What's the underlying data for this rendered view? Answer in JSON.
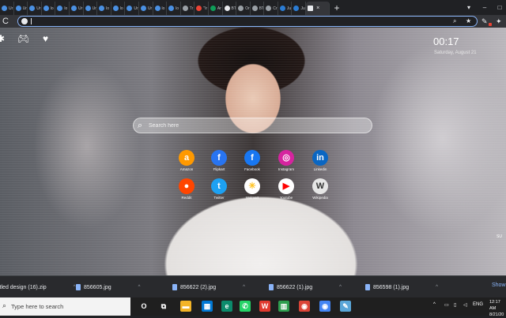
{
  "tabs": [
    {
      "label": "Ur",
      "icon": "chrome-extension-icon",
      "color": "#4a90e2"
    },
    {
      "label": "Ur",
      "icon": "chrome-extension-icon",
      "color": "#4a90e2"
    },
    {
      "label": "Ur",
      "icon": "chrome-extension-icon",
      "color": "#4a90e2"
    },
    {
      "label": "lo",
      "icon": "chrome-extension-icon",
      "color": "#4a90e2"
    },
    {
      "label": "lo",
      "icon": "chrome-extension-icon",
      "color": "#4a90e2"
    },
    {
      "label": "Ur",
      "icon": "chrome-extension-icon",
      "color": "#4a90e2"
    },
    {
      "label": "Ur",
      "icon": "chrome-extension-icon",
      "color": "#4a90e2"
    },
    {
      "label": "lo",
      "icon": "chrome-extension-icon",
      "color": "#4a90e2"
    },
    {
      "label": "lo",
      "icon": "chrome-extension-icon",
      "color": "#4a90e2"
    },
    {
      "label": "Ur",
      "icon": "chrome-extension-icon",
      "color": "#4a90e2"
    },
    {
      "label": "Ur",
      "icon": "chrome-extension-icon",
      "color": "#4a90e2"
    },
    {
      "label": "lo",
      "icon": "chrome-extension-icon",
      "color": "#4a90e2"
    },
    {
      "label": "lo",
      "icon": "chrome-extension-icon",
      "color": "#4a90e2"
    },
    {
      "label": "Tr",
      "icon": "globe-icon",
      "color": "#9aa0a6"
    },
    {
      "label": "\"Ir",
      "icon": "gmail-icon",
      "color": "#ea4335"
    },
    {
      "label": "Ar",
      "icon": "sheets-icon",
      "color": "#0f9d58"
    },
    {
      "label": "BT",
      "icon": "chrome-icon",
      "color": "#e8eaed"
    },
    {
      "label": "Or",
      "icon": "globe-icon",
      "color": "#9aa0a6"
    },
    {
      "label": "BT",
      "icon": "globe-icon",
      "color": "#9aa0a6"
    },
    {
      "label": "Cr",
      "icon": "globe-icon",
      "color": "#9aa0a6"
    },
    {
      "label": "Ju",
      "icon": "word-icon",
      "color": "#2b7cd3"
    },
    {
      "label": "Ju",
      "icon": "word-icon",
      "color": "#2b7cd3"
    }
  ],
  "active_tab": {
    "icon": "photo-icon",
    "close": "×"
  },
  "new_tab": "+",
  "window_controls": {
    "minimize": "–",
    "menu": "▾"
  },
  "toolbar": {
    "reload": "C",
    "omnibox_value": "",
    "colors": {
      "focus": "#8ab4f8",
      "ext_badge": "#ea4335"
    }
  },
  "page": {
    "clock": "00:17",
    "date": "Saturday, August 21",
    "search_placeholder": "Search here",
    "corner_text": "SU"
  },
  "apps": [
    {
      "label": "Amazon",
      "icon": "amazon-icon",
      "color": "#ff9900",
      "glyph": "a"
    },
    {
      "label": "Flipkart",
      "icon": "flipkart-icon",
      "color": "#2874f0",
      "glyph": "f"
    },
    {
      "label": "Facebook",
      "icon": "facebook-icon",
      "color": "#1877f2",
      "glyph": "f"
    },
    {
      "label": "Instagram",
      "icon": "instagram-icon",
      "color": "#d6249f",
      "glyph": "◎"
    },
    {
      "label": "Linkedin",
      "icon": "linkedin-icon",
      "color": "#0a66c2",
      "glyph": "in"
    },
    {
      "label": "Reddit",
      "icon": "reddit-icon",
      "color": "#ff4500",
      "glyph": "●"
    },
    {
      "label": "Twitter",
      "icon": "twitter-icon",
      "color": "#1da1f2",
      "glyph": "t"
    },
    {
      "label": "Walmart",
      "icon": "walmart-icon",
      "color": "#ffffff",
      "glyph": "✳"
    },
    {
      "label": "Youtube",
      "icon": "youtube-icon",
      "color": "#ffffff",
      "glyph": "▶"
    },
    {
      "label": "Wikipedia",
      "icon": "wikipedia-icon",
      "color": "#e6e6e6",
      "glyph": "W"
    }
  ],
  "downloads": {
    "items": [
      {
        "name": "itled design (16).zip"
      },
      {
        "name": "856605.jpg"
      },
      {
        "name": "856622 (2).jpg"
      },
      {
        "name": "856622 (1).jpg"
      },
      {
        "name": "856598 (1).jpg"
      }
    ],
    "show_all": "Show"
  },
  "taskbar": {
    "search_placeholder": "Type here to search",
    "apps": [
      {
        "icon": "cortana-icon",
        "glyph": "O",
        "color": "#1f1f1f"
      },
      {
        "icon": "task-view-icon",
        "glyph": "⧉",
        "color": "#1f1f1f"
      },
      {
        "icon": "file-explorer-icon",
        "glyph": "▬",
        "color": "#f3b427"
      },
      {
        "icon": "store-icon",
        "glyph": "▦",
        "color": "#0078d4"
      },
      {
        "icon": "edge-icon",
        "glyph": "e",
        "color": "#0c8b6c"
      },
      {
        "icon": "whatsapp-icon",
        "glyph": "✆",
        "color": "#25d366"
      },
      {
        "icon": "wps-icon",
        "glyph": "W",
        "color": "#e03a2f"
      },
      {
        "icon": "sheets-app-icon",
        "glyph": "▥",
        "color": "#2e9e4f"
      },
      {
        "icon": "chrome-taskbar-icon",
        "glyph": "◉",
        "color": "#db4437"
      },
      {
        "icon": "chrome-beta-icon",
        "glyph": "◉",
        "color": "#4285f4"
      },
      {
        "icon": "notepad-icon",
        "glyph": "✎",
        "color": "#5aa6d8"
      }
    ],
    "tray": {
      "chevron": "^",
      "lang": "ENG",
      "time": "12:17 AM",
      "date": "8/21/20"
    }
  }
}
